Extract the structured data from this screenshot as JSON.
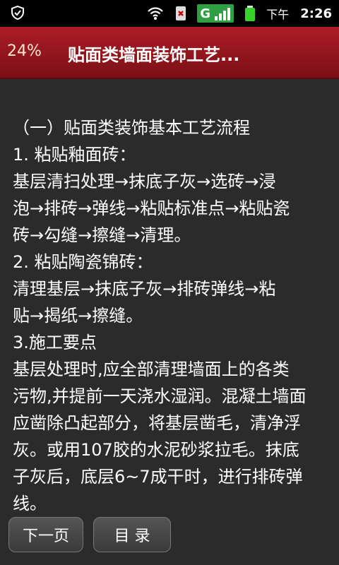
{
  "status_bar": {
    "ampm": "下午",
    "time": "2:26",
    "network": "G"
  },
  "title_bar": {
    "progress": "24%",
    "title": "贴面类墙面装饰工艺..."
  },
  "content": {
    "lines": [
      "（一）贴面类装饰基本工艺流程",
      "  1. 粘贴釉面砖：",
      " 基层清扫处理→抹底子灰→选砖→浸",
      "泡→排砖→弹线→粘贴标准点→粘贴瓷",
      "砖→勾缝→擦缝→清理。",
      "  2. 粘贴陶瓷锦砖：",
      " 清理基层→抹底子灰→排砖弹线→粘",
      "贴→揭纸→擦缝。",
      "  3.施工要点",
      " 基层处理时,应全部清理墙面上的各类",
      "污物,并提前一天浇水湿润。混凝土墙面",
      "应凿除凸起部分，将基层凿毛，清净浮",
      "灰。或用107胶的水泥砂浆拉毛。抹底",
      "子灰后，底层6~7成干时，进行排砖弹",
      "线。"
    ]
  },
  "buttons": {
    "next": "下一页",
    "toc": "目 录"
  },
  "colors": {
    "title_bg": "#a81a22",
    "content_bg": "#2b2b2b",
    "progress_text": "#ffe7c9"
  }
}
